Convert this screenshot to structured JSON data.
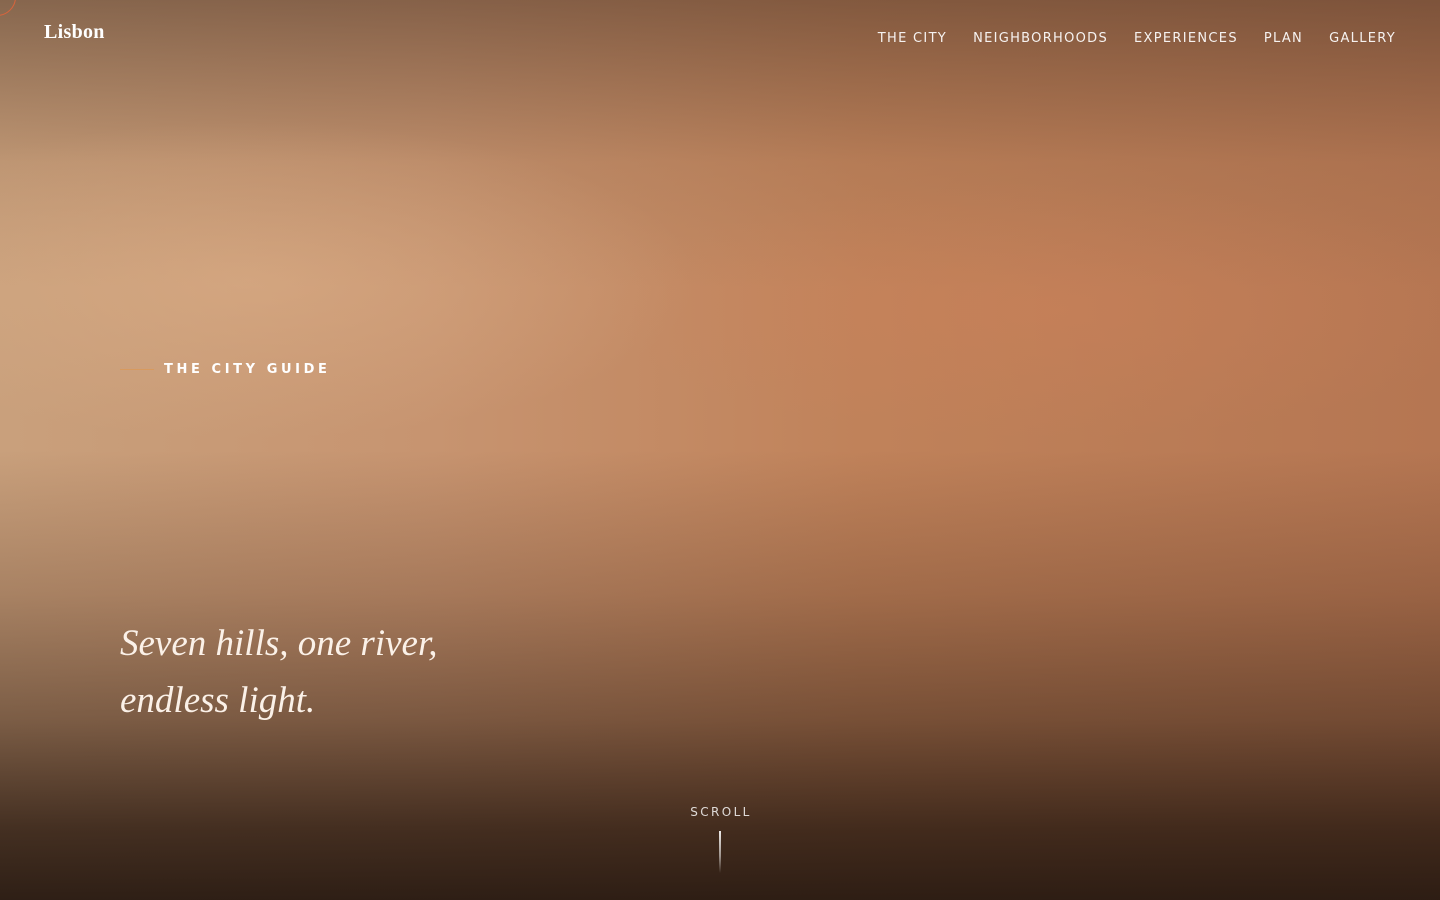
{
  "brand": {
    "logo": "Lisbon"
  },
  "nav": {
    "items": [
      {
        "label": "THE CITY"
      },
      {
        "label": "NEIGHBORHOODS"
      },
      {
        "label": "EXPERIENCES"
      },
      {
        "label": "PLAN"
      },
      {
        "label": "GALLERY"
      }
    ]
  },
  "hero": {
    "eyebrow": "THE CITY GUIDE",
    "headline_lines": [
      "Seven hills, one river,",
      "endless light."
    ],
    "scroll_label": "SCROLL"
  },
  "colors": {
    "accent": "#d89a5e",
    "corner_ring": "#d9643c",
    "sky_light": "#c9a07c",
    "sky_warm": "#c0825a",
    "shadow_dark": "#2e1d13"
  },
  "icons": {
    "corner": "circle-outline-icon",
    "scroll": "scroll-line-indicator"
  }
}
